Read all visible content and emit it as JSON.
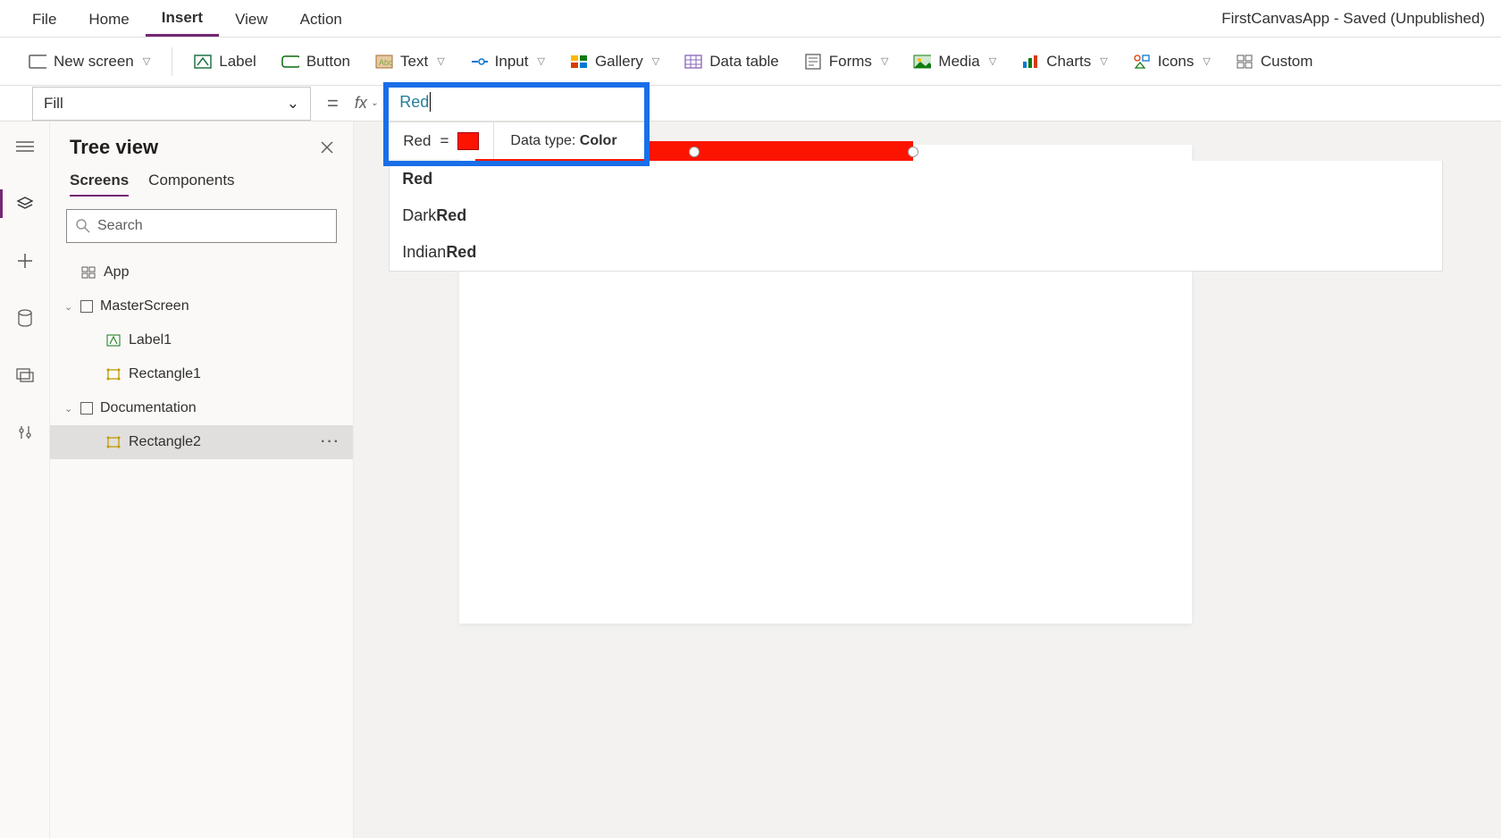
{
  "app_title": "FirstCanvasApp - Saved (Unpublished)",
  "menubar": {
    "items": [
      "File",
      "Home",
      "Insert",
      "View",
      "Action"
    ],
    "active": "Insert"
  },
  "ribbon": {
    "new_screen": "New screen",
    "label": "Label",
    "button": "Button",
    "text": "Text",
    "input": "Input",
    "gallery": "Gallery",
    "data_table": "Data table",
    "forms": "Forms",
    "media": "Media",
    "charts": "Charts",
    "icons": "Icons",
    "custom": "Custom"
  },
  "property_selector": {
    "value": "Fill"
  },
  "formula": {
    "text": "Red",
    "result_label": "Red",
    "data_type_label": "Data type: ",
    "data_type_value": "Color",
    "swatch_color": "#fd1400"
  },
  "autocomplete": {
    "options": [
      {
        "prefix": "",
        "match": "Red"
      },
      {
        "prefix": "Dark",
        "match": "Red"
      },
      {
        "prefix": "Indian",
        "match": "Red"
      }
    ]
  },
  "treeview": {
    "title": "Tree view",
    "tabs": [
      "Screens",
      "Components"
    ],
    "active_tab": "Screens",
    "search_placeholder": "Search",
    "nodes": {
      "app": "App",
      "master_screen": "MasterScreen",
      "label1": "Label1",
      "rect1": "Rectangle1",
      "documentation": "Documentation",
      "rect2": "Rectangle2"
    }
  },
  "selection": {
    "element": "Rectangle2",
    "fill_color": "#fd1400"
  }
}
